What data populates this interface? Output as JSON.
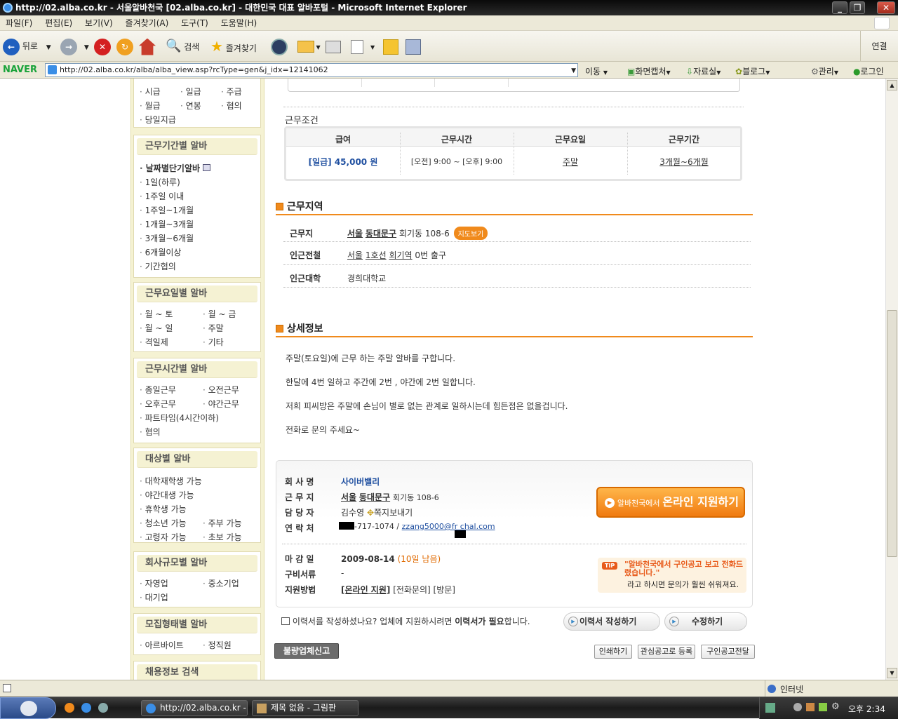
{
  "window": {
    "title": "http://02.alba.co.kr - 서울알바천국 [02.alba.co.kr] - 대한민국 대표 알바포털 - Microsoft Internet Explorer"
  },
  "menu": [
    "파일(F)",
    "편집(E)",
    "보기(V)",
    "즐겨찾기(A)",
    "도구(T)",
    "도움말(H)"
  ],
  "toolbar": {
    "back": "뒤로",
    "search": "검색",
    "favorites": "즐겨찾기",
    "connect": "연결"
  },
  "addressbar": {
    "brand": "NAVER",
    "url": "http://02.alba.co.kr/alba/alba_view.asp?rcType=gen&j_idx=12141062",
    "go": "이동",
    "capture": "화면캡처",
    "materials": "자료실",
    "blog": "블로그",
    "manage": "관리",
    "login": "로그인"
  },
  "sidebar": {
    "pay_items": [
      "시급",
      "일급",
      "주급",
      "월급",
      "연봉",
      "협의",
      "당일지급"
    ],
    "period": {
      "title": "근무기간별 알바",
      "items": [
        "날짜별단기알바",
        "1일(하루)",
        "1주일 이내",
        "1주일~1개월",
        "1개월~3개월",
        "3개월~6개월",
        "6개월이상",
        "기간협의"
      ]
    },
    "days": {
      "title": "근무요일별 알바",
      "items": [
        "월 ~ 토",
        "월 ~ 금",
        "월 ~ 일",
        "주말",
        "격일제",
        "기타"
      ]
    },
    "time": {
      "title": "근무시간별 알바",
      "items": [
        "종일근무",
        "오전근무",
        "오후근무",
        "야간근무",
        "파트타임(4시간이하)",
        "협의"
      ]
    },
    "target": {
      "title": "대상별 알바",
      "items": [
        "대학재학생 가능",
        "야간대생 가능",
        "휴학생 가능",
        "청소년 가능",
        "주부 가능",
        "고령자 가능",
        "초보 가능"
      ]
    },
    "company_size": {
      "title": "회사규모별 알바",
      "items": [
        "자영업",
        "중소기업",
        "대기업"
      ]
    },
    "form": {
      "title": "모집형태별 알바",
      "items": [
        "아르바이트",
        "정직원"
      ]
    },
    "search": {
      "title": "채용정보 검색"
    }
  },
  "conditions": {
    "title": "근무조건",
    "headers": [
      "급여",
      "근무시간",
      "근무요일",
      "근무기간"
    ],
    "pay": "[일급] 45,000 원",
    "hours": "[오전] 9:00 ~ [오후] 9:00",
    "days": "주말",
    "period": "3개월~6개월"
  },
  "area": {
    "title": "근무지역",
    "work_label": "근무지",
    "work_city": "서울",
    "work_district": "동대문구",
    "work_addr": "회기동 108-6",
    "map_btn": "지도보기",
    "subway_label": "인근전철",
    "subway_city": "서울",
    "subway_line": "1호선",
    "subway_station": "회기역",
    "subway_exit": "0번 출구",
    "univ_label": "인근대학",
    "univ": "경희대학교"
  },
  "detail": {
    "title": "상세정보",
    "lines": [
      "주말(토요일)에 근무 하는 주말 알바를 구합니다.",
      "한달에 4번 일하고 주간에 2번 , 야간에 2번 일합니다.",
      "저희 피씨방은 주말에 손님이 별로 없는 관계로 일하시는데 힘든점은 없을겁니다.",
      "전화로 문의 주세요~"
    ]
  },
  "company": {
    "name_label": "회 사 명",
    "name": "사이버밸리",
    "loc_label": "근 무 지",
    "loc_city": "서울",
    "loc_district": "동대문구",
    "loc_addr": "회기동 108-6",
    "manager_label": "담 당 자",
    "manager": "김수영",
    "note_btn": "쪽지보내기",
    "contact_label": "연 락 처",
    "phone": "-717-1074 /",
    "email": "zzang5000@fr  chal.com",
    "apply_prefix": "알바천국에서",
    "apply_main": "온라인 지원하기",
    "deadline_label": "마 감 일",
    "deadline": "2009-08-14",
    "deadline_left": "(10일 남음)",
    "docs_label": "구비서류",
    "docs": "-",
    "method_label": "지원방법",
    "method_online": "[온라인 지원]",
    "method_rest": "[전화문의] [방문]",
    "tip_badge": "TIP",
    "tip_quote": "\"알바천국에서 구인공고 보고 전화드렸습니다.\"",
    "tip_rest": "라고 하시면 문의가 훨씬 쉬워져요."
  },
  "resume": {
    "text_pre": "이력서를 작성하셨나요? 업체에 지원하시려면",
    "text_bold": "이력서가 필요",
    "text_post": "합니다.",
    "write_btn": "이력서 작성하기",
    "edit_btn": "수정하기"
  },
  "actions": {
    "report": "불량업체신고",
    "print": "인쇄하기",
    "interest": "관심공고로 등록",
    "forward": "구인공고전달"
  },
  "status": {
    "zone": "인터넷"
  },
  "taskbar": {
    "task1": "http://02.alba.co.kr - ...",
    "task2": "제목 없음 - 그림판",
    "clock": "오후 2:34"
  }
}
